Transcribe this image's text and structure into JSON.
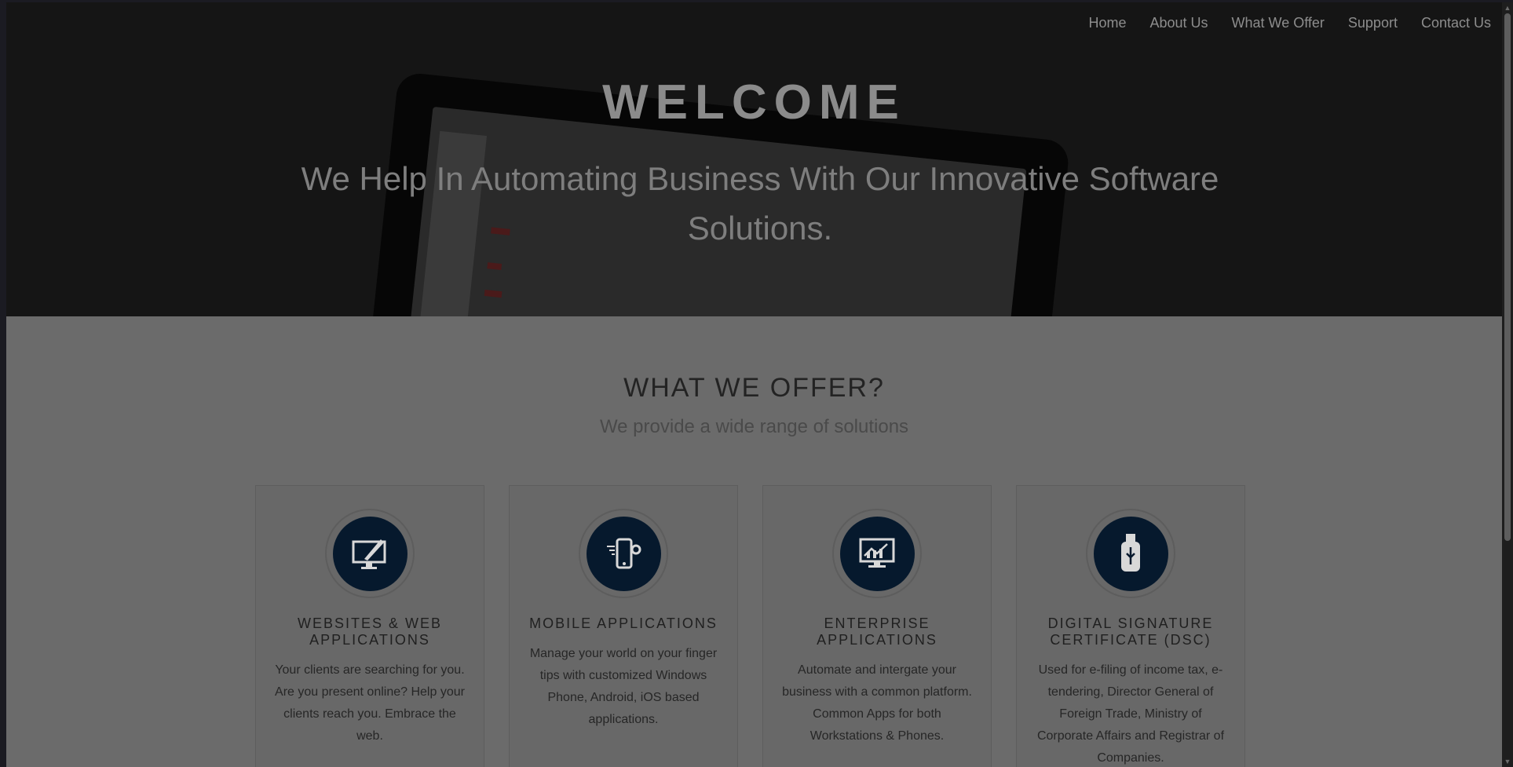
{
  "nav": [
    "Home",
    "About Us",
    "What We Offer",
    "Support",
    "Contact Us"
  ],
  "hero": {
    "title": "WELCOME",
    "subtitle": "We Help In Automating Business With Our Innovative Software Solutions."
  },
  "offer": {
    "title": "WHAT WE OFFER?",
    "subtitle": "We provide a wide range of solutions",
    "cards": [
      {
        "icon": "monitor-pen-icon",
        "title": "WEBSITES & WEB APPLICATIONS",
        "text": "Your clients are searching for you. Are you present online? Help your clients reach you. Embrace the web."
      },
      {
        "icon": "mobile-settings-icon",
        "title": "MOBILE APPLICATIONS",
        "text": "Manage your world on your finger tips with customized Windows Phone, Android, iOS based applications."
      },
      {
        "icon": "analytics-monitor-icon",
        "title": "ENTERPRISE APPLICATIONS",
        "text": "Automate and intergate your business with a common platform. Common Apps for both Workstations & Phones."
      },
      {
        "icon": "usb-token-icon",
        "title": "DIGITAL SIGNATURE CERTIFICATE (DSC)",
        "text": "Used for e-filing of income tax, e-tendering, Director General of Foreign Trade, Ministry of Corporate Affairs and Registrar of Companies."
      }
    ]
  },
  "colors": {
    "icon_circle": "#06192d",
    "overlay_background": "#6b6b6b"
  }
}
